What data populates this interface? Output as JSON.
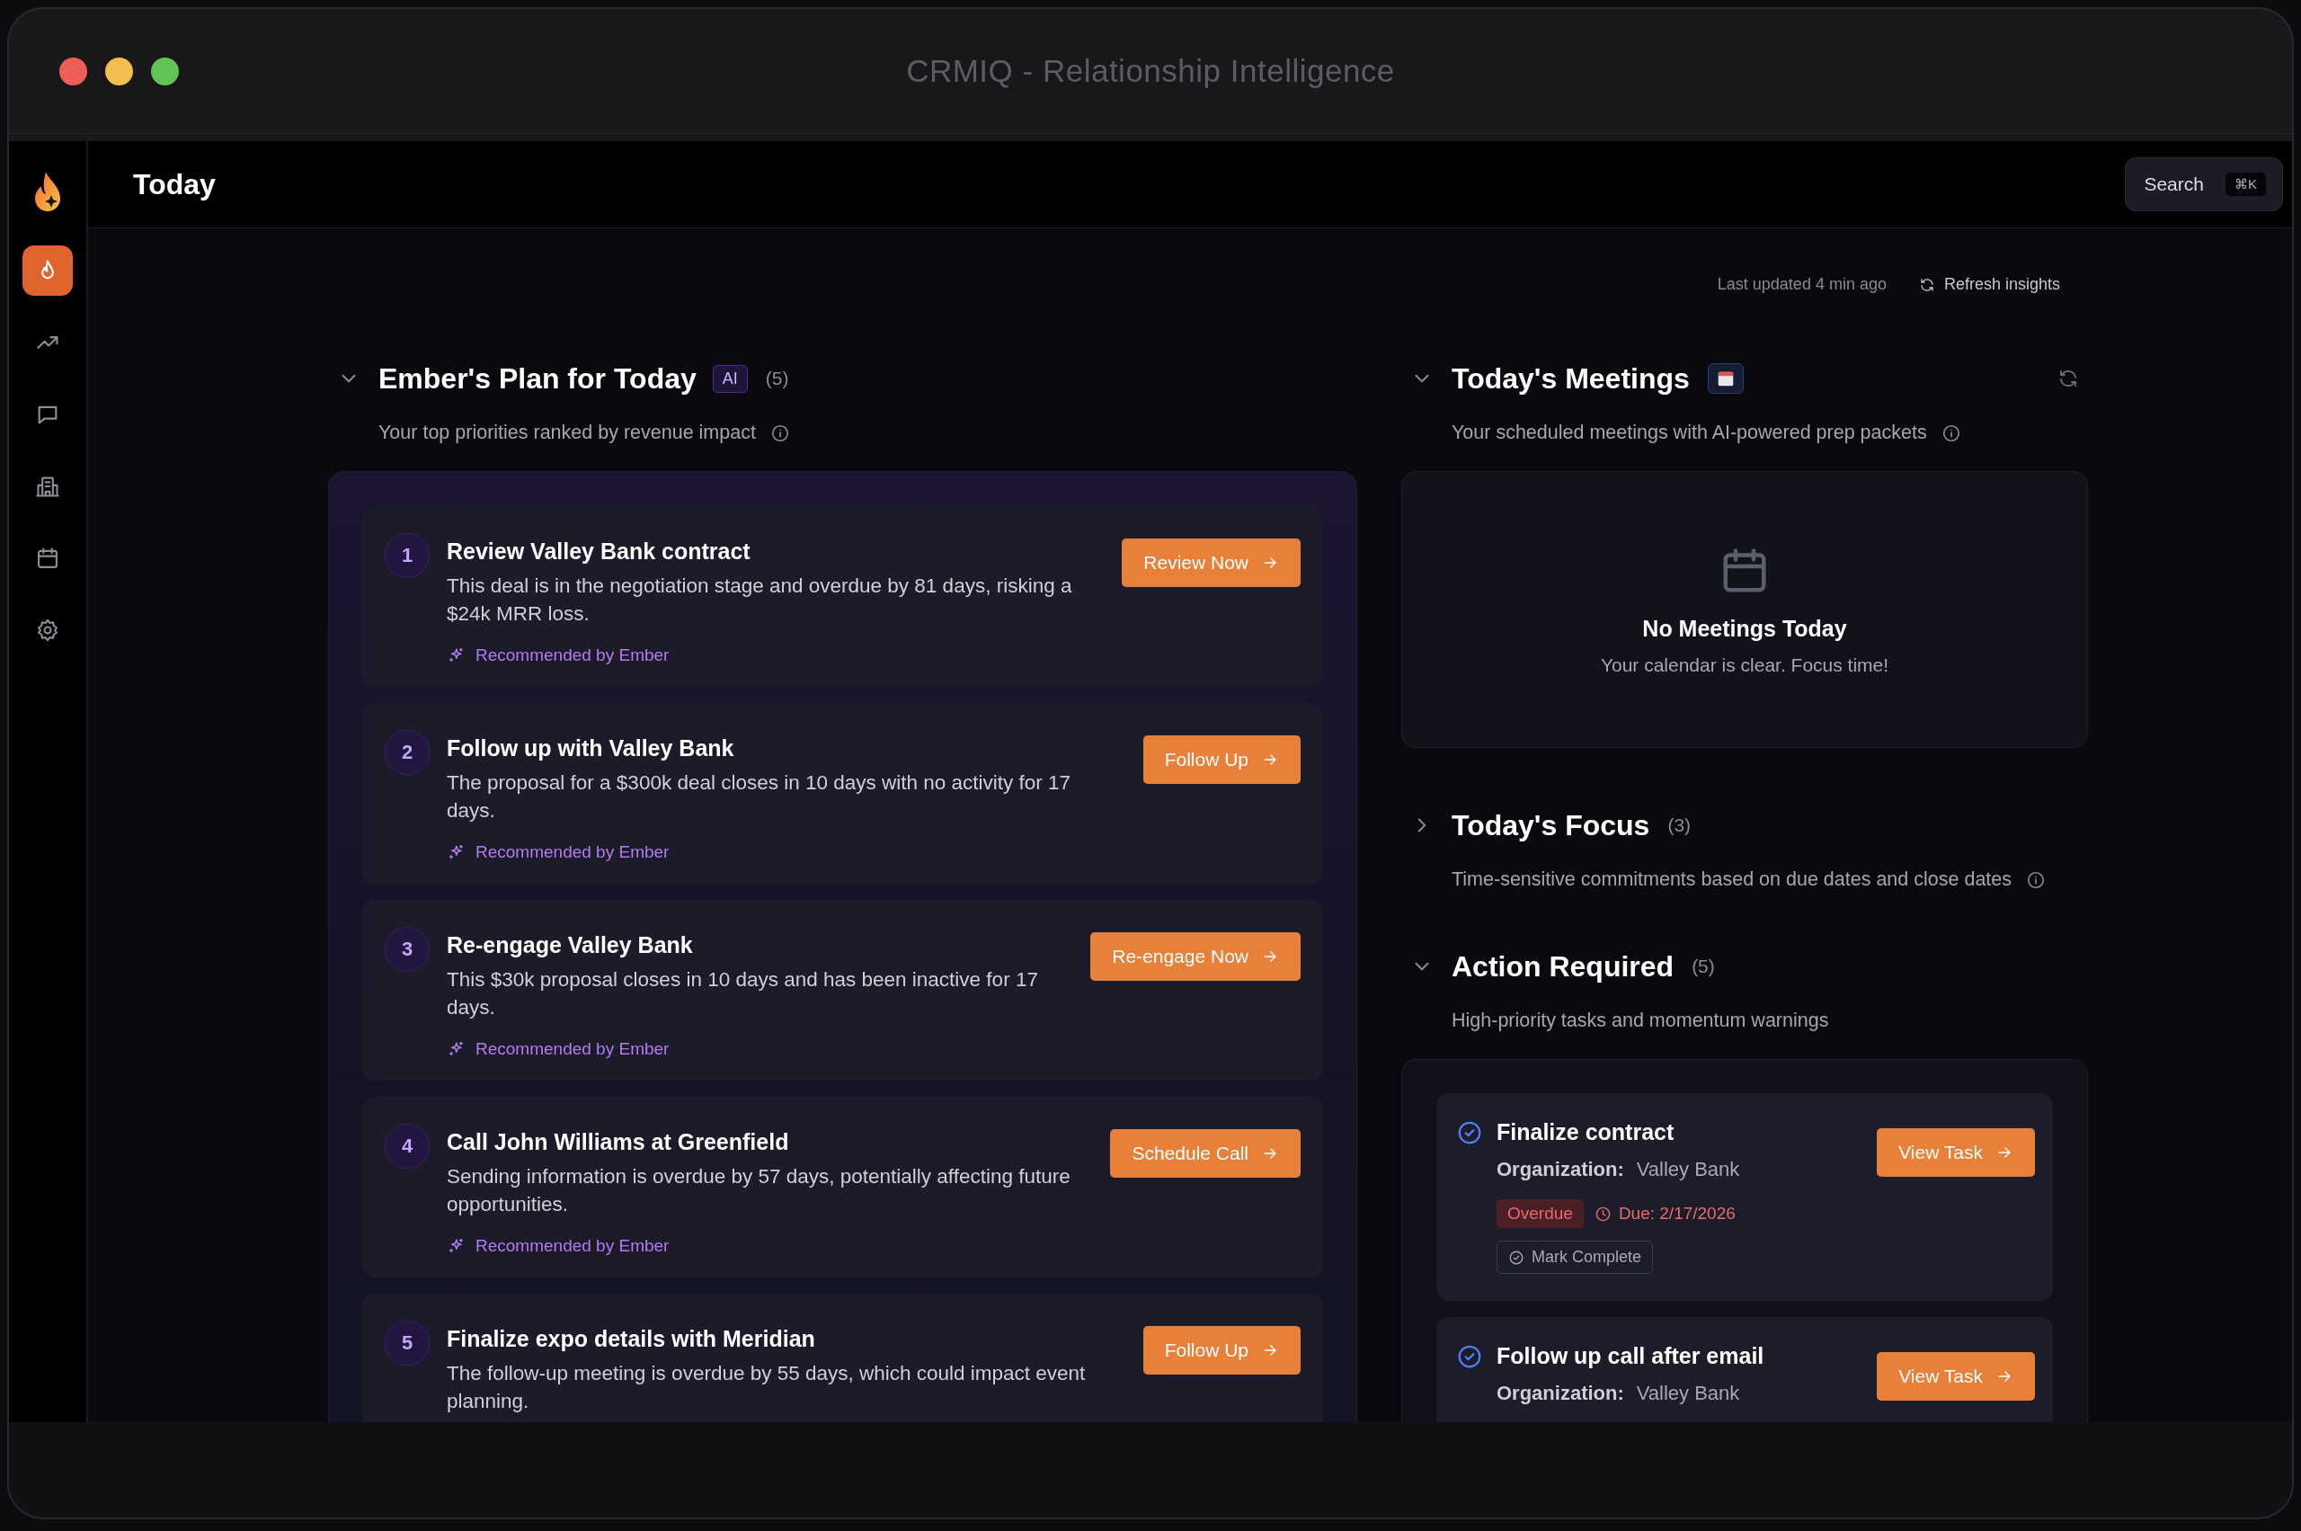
{
  "window": {
    "title": "CRMIQ - Relationship Intelligence"
  },
  "sidebar": {
    "items": [
      {
        "kind": "flame",
        "selected": true
      },
      {
        "kind": "trend",
        "selected": false
      },
      {
        "kind": "chat",
        "selected": false
      },
      {
        "kind": "building",
        "selected": false
      },
      {
        "kind": "calendar",
        "selected": false
      },
      {
        "kind": "gear",
        "selected": false
      }
    ]
  },
  "header": {
    "title": "Today",
    "search": {
      "label": "Search",
      "shortcut": "⌘K"
    }
  },
  "status": {
    "last_updated": "Last updated 4 min ago",
    "refresh": "Refresh insights"
  },
  "plan": {
    "title": "Ember's Plan for Today",
    "badge": "AI",
    "count": "(5)",
    "expanded": true,
    "subtitle": "Your top priorities ranked by revenue impact",
    "items": [
      {
        "number": "1",
        "title": "Review Valley Bank contract",
        "description": "This deal is in the negotiation stage and overdue by 81 days, risking a $24k MRR loss.",
        "action": "Review Now",
        "recommendation": "Recommended by Ember"
      },
      {
        "number": "2",
        "title": "Follow up with Valley Bank",
        "description": "The proposal for a $300k deal closes in 10 days with no activity for 17 days.",
        "action": "Follow Up",
        "recommendation": "Recommended by Ember"
      },
      {
        "number": "3",
        "title": "Re-engage Valley Bank",
        "description": "This $30k proposal closes in 10 days and has been inactive for 17 days.",
        "action": "Re-engage Now",
        "recommendation": "Recommended by Ember"
      },
      {
        "number": "4",
        "title": "Call John Williams at Greenfield",
        "description": "Sending information is overdue by 57 days, potentially affecting future opportunities.",
        "action": "Schedule Call",
        "recommendation": "Recommended by Ember"
      },
      {
        "number": "5",
        "title": "Finalize expo details with Meridian",
        "description": "The follow-up meeting is overdue by 55 days, which could impact event planning.",
        "action": "Follow Up"
      }
    ]
  },
  "meetings": {
    "title": "Today's Meetings",
    "expanded": true,
    "subtitle": "Your scheduled meetings with AI-powered prep packets",
    "empty_title": "No Meetings Today",
    "empty_text": "Your calendar is clear. Focus time!"
  },
  "focus": {
    "title": "Today's Focus",
    "count": "(3)",
    "expanded": false,
    "subtitle": "Time-sensitive commitments based on due dates and close dates"
  },
  "action_required": {
    "title": "Action Required",
    "count": "(5)",
    "expanded": true,
    "subtitle": "High-priority tasks and momentum warnings",
    "tasks": [
      {
        "title": "Finalize contract",
        "org_label": "Organization:",
        "organization": "Valley Bank",
        "status": "Overdue",
        "due": "Due: 2/17/2026",
        "complete_label": "Mark Complete",
        "action": "View Task"
      },
      {
        "title": "Follow up call after email",
        "org_label": "Organization:",
        "organization": "Valley Bank",
        "action": "View Task"
      }
    ]
  }
}
